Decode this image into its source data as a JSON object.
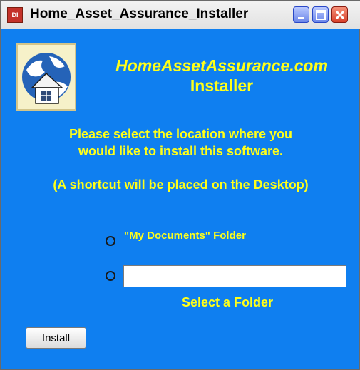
{
  "window": {
    "title": "Home_Asset_Assurance_Installer",
    "icon_label": "DI",
    "controls": [
      "minimize-icon",
      "maximize-icon",
      "close-icon"
    ]
  },
  "header": {
    "brand": "HomeAssetAssurance.com",
    "subtitle": "Installer",
    "logo": "globe-house-logo"
  },
  "instructions": {
    "line1": "Please select the location where you",
    "line2": "would like to install this software.",
    "shortcut_note": "(A shortcut will be placed on the Desktop)"
  },
  "options": {
    "my_documents_label": "\"My Documents\" Folder",
    "custom_folder_value": "",
    "select_folder_label": "Select a Folder"
  },
  "buttons": {
    "install": "Install"
  },
  "colors": {
    "background": "#0f7ff0",
    "text_accent": "#ffff19"
  }
}
